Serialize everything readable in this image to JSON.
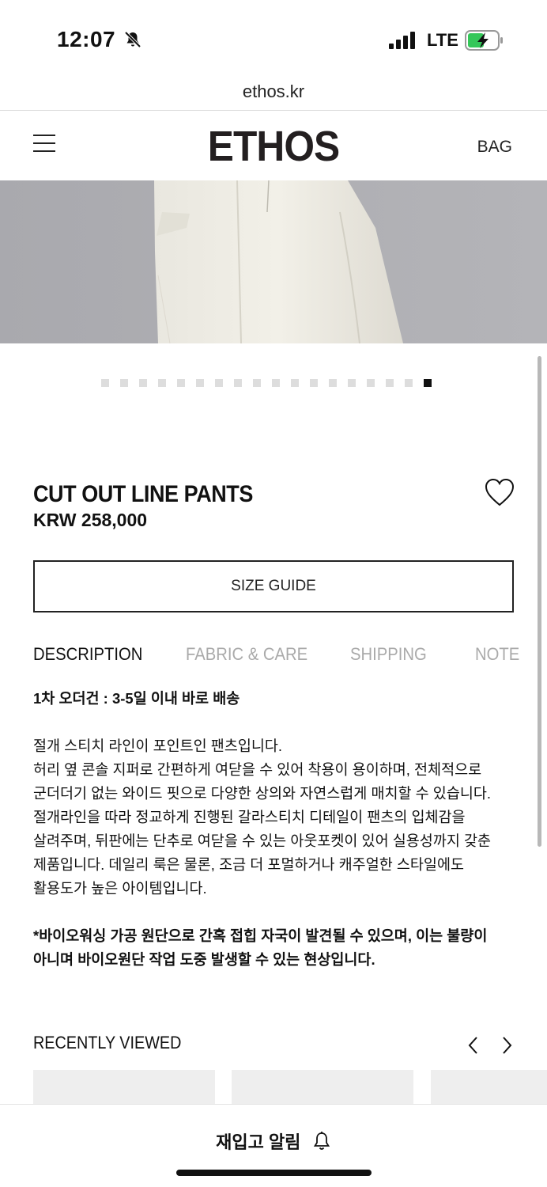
{
  "status_bar": {
    "time": "12:07",
    "network": "LTE",
    "icons": [
      "bell-muted-icon",
      "signal-icon",
      "battery-charging-icon"
    ]
  },
  "browser": {
    "url": "ethos.kr"
  },
  "header": {
    "logo": "ETHOS",
    "bag_label": "BAG",
    "menu_icon": "hamburger-menu-icon"
  },
  "gallery": {
    "total_images": 18,
    "active_index": 17
  },
  "product": {
    "name": "CUT OUT LINE PANTS",
    "price": "KRW 258,000",
    "wishlist_icon": "heart-outline-icon",
    "size_guide_label": "SIZE GUIDE"
  },
  "tabs": [
    {
      "label": "DESCRIPTION",
      "active": true
    },
    {
      "label": "FABRIC & CARE",
      "active": false
    },
    {
      "label": "SHIPPING",
      "active": false
    },
    {
      "label": "NOTE",
      "active": false
    }
  ],
  "description": {
    "notice": "1차 오더건 : 3-5일 이내 바로 배송",
    "lines": [
      "절개 스티치 라인이 포인트인 팬츠입니다.",
      "허리 옆 콘솔 지퍼로 간편하게 여닫을 수 있어 착용이 용이하며, 전체적으로",
      "군더더기 없는 와이드 핏으로 다양한 상의와 자연스럽게 매치할 수 있습니다.",
      "절개라인을 따라 정교하게 진행된 갈라스티치 디테일이 팬츠의 입체감을",
      "살려주며, 뒤판에는 단추로 여닫을 수 있는 아웃포켓이 있어 실용성까지 갖춘",
      "제품입니다. 데일리 룩은 물론, 조금 더 포멀하거나 캐주얼한 스타일에도",
      "활용도가 높은 아이템입니다."
    ],
    "warning_lines": [
      "*바이오워싱 가공 원단으로 간혹 접힙 자국이 발견될 수 있으며, 이는 불량이",
      "아니며 바이오원단 작업 도중 발생할 수 있는 현상입니다."
    ]
  },
  "recently_viewed": {
    "title": "RECENTLY VIEWED",
    "prev_icon": "chevron-left-icon",
    "next_icon": "chevron-right-icon"
  },
  "bottom": {
    "restock_label": "재입고 알림",
    "restock_icon": "bell-icon"
  }
}
